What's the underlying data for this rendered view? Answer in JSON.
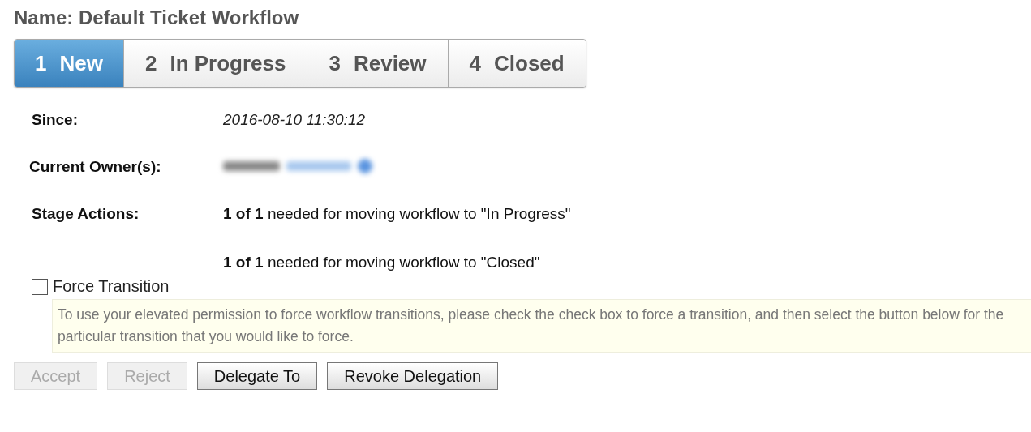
{
  "title": "Name: Default Ticket Workflow",
  "stages": [
    {
      "number": "1",
      "label": "New",
      "selected": true
    },
    {
      "number": "2",
      "label": "In Progress",
      "selected": false
    },
    {
      "number": "3",
      "label": "Review",
      "selected": false
    },
    {
      "number": "4",
      "label": "Closed",
      "selected": false
    }
  ],
  "details": {
    "since_label": "Since:",
    "since_value": "2016-08-10 11:30:12",
    "owner_label": "Current Owner(s):",
    "actions_label": "Stage Actions:",
    "actions": [
      "**1 of 1** needed for moving workflow to \"In Progress\"",
      "**1 of 1** needed for moving workflow to \"Closed\""
    ]
  },
  "force": {
    "label": "Force Transition",
    "checked": false,
    "notice": "To use your elevated permission to force workflow transitions, please check the check box to force a transition, and then select the button below for the particular transition that you would like to force."
  },
  "buttons": [
    {
      "label": "Accept",
      "disabled": true
    },
    {
      "label": "Reject",
      "disabled": true
    },
    {
      "label": "Delegate To",
      "disabled": false
    },
    {
      "label": "Revoke Delegation",
      "disabled": false
    }
  ]
}
